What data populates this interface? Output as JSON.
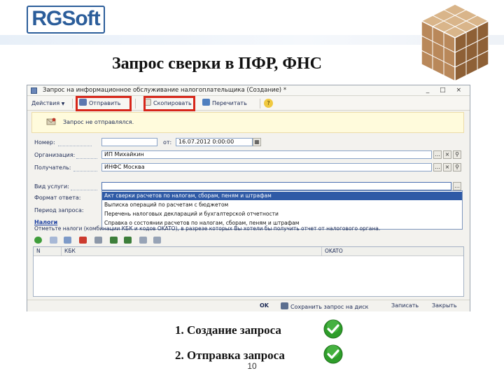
{
  "slide": {
    "logo": "RGSoft",
    "title": "Запрос сверки в ПФР, ФНС",
    "steps": [
      "1. Создание запроса",
      "2. Отправка запроса"
    ],
    "page_number": "10"
  },
  "window": {
    "title": "Запрос на информационное обслуживание налогоплательщика (Создание) *",
    "controls": "_ □ ×"
  },
  "toolbar": {
    "actions_label": "Действия",
    "send_label": "Отправить",
    "copy_label": "Скопировать",
    "reread_label": "Перечитать",
    "help_label": "?"
  },
  "status": {
    "text": "Запрос не отправлялся."
  },
  "form": {
    "number_label": "Номер:",
    "number_value": "",
    "from_label": "от:",
    "date_value": "16.07.2012 0:00:00",
    "org_label": "Организация:",
    "org_value": "ИП Михайкин",
    "recipient_label": "Получатель:",
    "recipient_value": "ИНФС Москва",
    "service_label": "Вид услуги:",
    "service_value": "",
    "format_label": "Формат ответа:",
    "period_label": "Период запроса:"
  },
  "dropdown": {
    "items": [
      "Акт сверки расчетов по налогам, сборам, пеням и штрафам",
      "Выписка операций по расчетам с бюджетом",
      "Перечень налоговых деклараций и бухгалтерской отчетности",
      "Справка о состоянии расчетов по налогам, сборам, пеням и штрафам"
    ],
    "selected_index": 0
  },
  "taxes": {
    "label": "Налоги",
    "hint": "Отметьте налоги (комбинации КБК и кодов OKATO), в разрезе которых Вы хотели бы получить отчет от налогового органа."
  },
  "grid": {
    "columns": [
      "N",
      "КБК",
      "OKATO"
    ]
  },
  "bottom": {
    "ok_label": "OK",
    "save_label": "Сохранить запрос на диск",
    "write_label": "Записать",
    "close_label": "Закрыть"
  },
  "colors": {
    "highlight": "#d7261a",
    "selection": "#2f5aa6",
    "check": "#2e9d2a"
  }
}
